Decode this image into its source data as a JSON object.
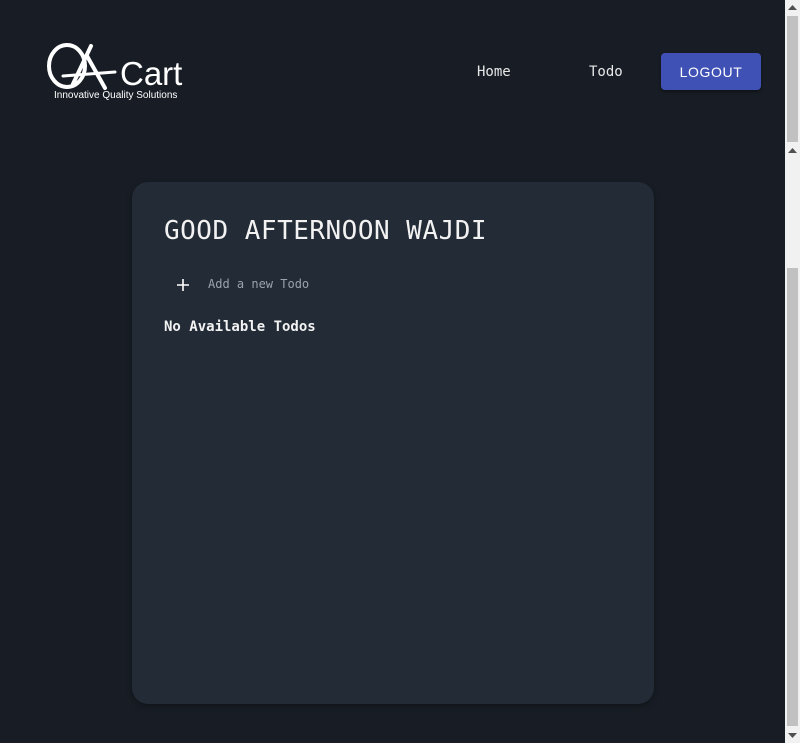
{
  "header": {
    "logo": {
      "wordmark": "QACart",
      "tagline": "Innovative Quality Solutions"
    },
    "nav": {
      "home_label": "Home",
      "todo_label": "Todo"
    },
    "logout_label": "LOGOUT"
  },
  "main": {
    "greeting": "GOOD AFTERNOON WAJDI",
    "add_todo_label": "Add a new Todo",
    "add_icon": "plus-icon",
    "empty_message": "No Available Todos"
  },
  "colors": {
    "background": "#181d25",
    "card": "#222b36",
    "accent": "#3f51b5"
  }
}
